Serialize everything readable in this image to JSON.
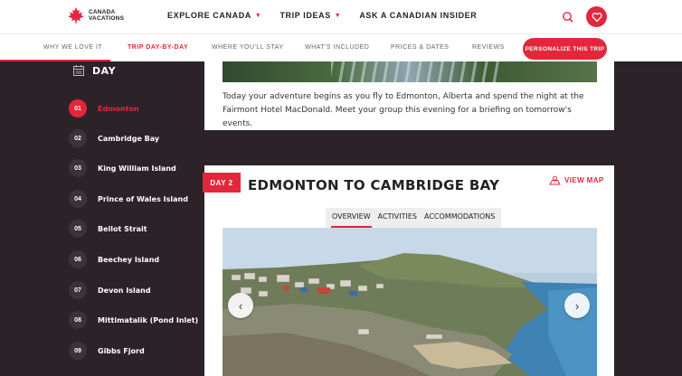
{
  "brand": {
    "name": "CANADA VACATIONS",
    "accent": "#e3263c"
  },
  "topnav": {
    "items": [
      {
        "label": "EXPLORE CANADA",
        "has_dropdown": true
      },
      {
        "label": "TRIP IDEAS",
        "has_dropdown": true
      },
      {
        "label": "ASK A CANADIAN INSIDER",
        "has_dropdown": false
      }
    ],
    "icons": [
      "search-icon",
      "heart-icon"
    ]
  },
  "subnav": {
    "items": [
      {
        "label": "WHY WE LOVE IT"
      },
      {
        "label": "TRIP DAY-BY-DAY",
        "active": true
      },
      {
        "label": "WHERE YOU'LL STAY"
      },
      {
        "label": "WHAT'S INCLUDED"
      },
      {
        "label": "PRICES & DATES"
      },
      {
        "label": "REVIEWS"
      }
    ],
    "cta": "PERSONALIZE THIS TRIP"
  },
  "sidebar": {
    "header": "DAY",
    "items": [
      {
        "num": "01",
        "label": "Edmonton",
        "active": true
      },
      {
        "num": "02",
        "label": "Cambridge Bay"
      },
      {
        "num": "03",
        "label": "King William Island"
      },
      {
        "num": "04",
        "label": "Prince of Wales Island"
      },
      {
        "num": "05",
        "label": "Bellot Strait"
      },
      {
        "num": "06",
        "label": "Beechey Island"
      },
      {
        "num": "07",
        "label": "Devon Island"
      },
      {
        "num": "08",
        "label": "Mittimatalik (Pond Inlet)"
      },
      {
        "num": "09",
        "label": "Gibbs Fjord"
      }
    ]
  },
  "day1": {
    "text": "Today your adventure begins as you fly to Edmonton, Alberta and spend the night at the Fairmont Hotel MacDonald. Meet your group this evening for a briefing on tomorrow's events."
  },
  "day2": {
    "badge": "DAY 2",
    "title": "EDMONTON TO CAMBRIDGE BAY",
    "view_map": "VIEW MAP",
    "tabs": [
      {
        "label": "OVERVIEW",
        "active": true
      },
      {
        "label": "ACTIVITIES"
      },
      {
        "label": "ACCOMMODATIONS"
      }
    ]
  }
}
